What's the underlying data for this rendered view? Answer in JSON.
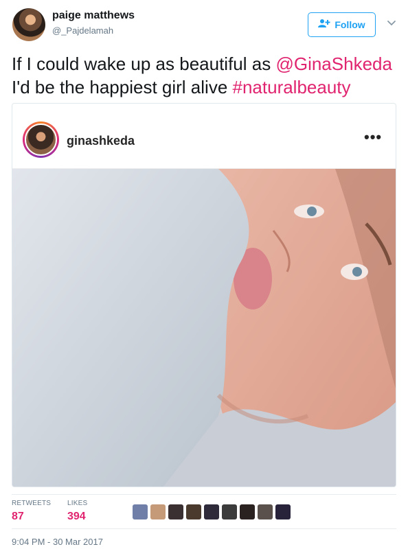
{
  "author": {
    "display_name": "paige matthews",
    "handle": "@_Pajdelamah"
  },
  "follow_button": {
    "label": "Follow",
    "accent_color": "#1da1f2"
  },
  "tweet": {
    "text_part1": "If I could wake up as beautiful as ",
    "mention": "@GinaShkeda",
    "text_part2": "I'd be the happiest girl alive ",
    "hashtag": "#naturalbeauty",
    "link_color": "#e0246f"
  },
  "embedded_post": {
    "username": "ginashkeda",
    "more_glyph": "•••"
  },
  "stats": {
    "retweets_label": "RETWEETS",
    "retweets_value": "87",
    "likes_label": "LIKES",
    "likes_value": "394"
  },
  "likers": [
    {
      "color": "#6f7fa8"
    },
    {
      "color": "#c59a78"
    },
    {
      "color": "#3a3032"
    },
    {
      "color": "#4a3a2e"
    },
    {
      "color": "#2e2a3a"
    },
    {
      "color": "#3b3b3b"
    },
    {
      "color": "#2a2220"
    },
    {
      "color": "#5a514c"
    },
    {
      "color": "#28233a"
    }
  ],
  "timestamp": "9:04 PM - 30 Mar 2017",
  "icons": {
    "follow": "add-person-icon",
    "menu": "chevron-down-icon",
    "more": "more-horizontal-icon"
  }
}
